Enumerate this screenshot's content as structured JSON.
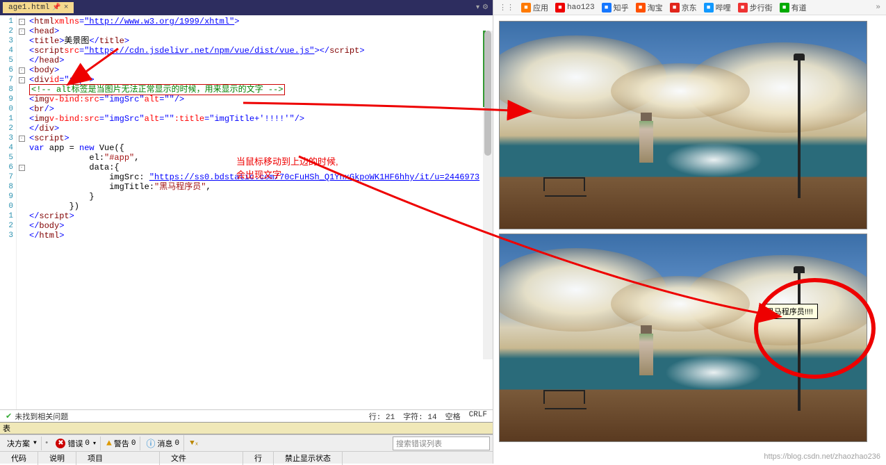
{
  "tab": {
    "filename": "age1.html",
    "pin_icon": "📌",
    "close_icon": "×"
  },
  "code": {
    "lines": [
      {
        "n": "1",
        "fold": "-",
        "html": "<span class='c-punct'>&lt;</span><span class='c-tag'>html</span> <span class='c-attr'>xmlns</span><span class='c-punct'>=</span><span class='c-link'>\"http://www.w3.org/1999/xhtml\"</span><span class='c-punct'>&gt;</span>"
      },
      {
        "n": "2",
        "fold": "-",
        "html": "<span class='c-punct'>&lt;</span><span class='c-tag'>head</span><span class='c-punct'>&gt;</span>"
      },
      {
        "n": "3",
        "fold": "",
        "html": "    <span class='c-punct'>&lt;</span><span class='c-tag'>title</span><span class='c-punct'>&gt;</span>美景图<span class='c-punct'>&lt;/</span><span class='c-tag'>title</span><span class='c-punct'>&gt;</span>"
      },
      {
        "n": "4",
        "fold": "",
        "html": "    <span class='c-punct'>&lt;</span><span class='c-tag'>script</span> <span class='c-attr'>src</span><span class='c-punct'>=</span><span class='c-link'>\"https://cdn.jsdelivr.net/npm/vue/dist/vue.js\"</span><span class='c-punct'>&gt;&lt;/</span><span class='c-tag'>script</span><span class='c-punct'>&gt;</span>"
      },
      {
        "n": "5",
        "fold": "",
        "html": "<span class='c-punct'>&lt;/</span><span class='c-tag'>head</span><span class='c-punct'>&gt;</span>"
      },
      {
        "n": "6",
        "fold": "-",
        "html": "<span class='c-punct'>&lt;</span><span class='c-tag'>body</span><span class='c-punct'>&gt;</span>"
      },
      {
        "n": "7",
        "fold": "-",
        "html": "    <span class='c-punct'>&lt;</span><span class='c-tag'>div</span> <span class='c-attr'>id</span><span class='c-punct'>=</span><span class='c-str'>\"app\"</span><span class='c-punct'>&gt;</span>"
      },
      {
        "n": "8",
        "fold": "",
        "html": "        <span class='hl-box'><span class='c-comment'>&lt;!-- alt标签是当图片无法正常显示的时候，用来显示的文字 --&gt;</span></span>"
      },
      {
        "n": "9",
        "fold": "",
        "html": "        <span class='c-punct'>&lt;</span><span class='c-tag'>img</span> <span class='c-attr'>v-bind:src</span><span class='c-punct'>=</span><span class='c-str'>\"imgSrc\"</span>   <span class='c-attr'>alt</span><span class='c-punct'>=</span><span class='c-str'>\"\"</span> <span class='c-punct'>/&gt;</span>"
      },
      {
        "n": "0",
        "fold": "",
        "html": "        <span class='c-punct'>&lt;</span><span class='c-tag'>br</span> <span class='c-punct'>/&gt;</span>"
      },
      {
        "n": "1",
        "fold": "",
        "html": "        <span class='c-punct'>&lt;</span><span class='c-tag'>img</span> <span class='c-attr'>v-bind:src</span><span class='c-punct'>=</span><span class='c-str'>\"imgSrc\"</span> <span class='c-attr'>alt</span><span class='c-punct'>=</span><span class='c-str'>\"\"</span> <span class='c-attr'>:title</span><span class='c-punct'>=</span><span class='c-str'>\"imgTitle+'!!!!'\"</span> <span class='c-punct'>/&gt;</span>"
      },
      {
        "n": "2",
        "fold": "",
        "html": "    <span class='c-punct'>&lt;/</span><span class='c-tag'>div</span><span class='c-punct'>&gt;</span>"
      },
      {
        "n": "3",
        "fold": "-",
        "html": "    <span class='c-punct'>&lt;</span><span class='c-tag'>script</span><span class='c-punct'>&gt;</span>"
      },
      {
        "n": "4",
        "fold": "",
        "html": "        <span class='c-kw'>var</span> app = <span class='c-kw'>new</span> Vue({"
      },
      {
        "n": "5",
        "fold": "",
        "html": "            el:<span class='c-jsstr'>\"#app\"</span>,"
      },
      {
        "n": "6",
        "fold": "-",
        "html": "            data:{"
      },
      {
        "n": "7",
        "fold": "",
        "html": "                imgSrc: <span class='c-link'>\"https://ss0.bdstatic.com/70cFuHSh_Q1YnxGkpoWK1HF6hhy/it/u=2446973</span>"
      },
      {
        "n": "8",
        "fold": "",
        "html": "                imgTitle:<span class='c-jsstr'>\"黑马程序员\"</span>,"
      },
      {
        "n": "9",
        "fold": "",
        "html": "            }"
      },
      {
        "n": "0",
        "fold": "",
        "html": "        })"
      },
      {
        "n": "1",
        "fold": "",
        "html": "    <span class='c-punct'>&lt;/</span><span class='c-tag'>script</span><span class='c-punct'>&gt;</span>"
      },
      {
        "n": "2",
        "fold": "",
        "html": "<span class='c-punct'>&lt;/</span><span class='c-tag'>body</span><span class='c-punct'>&gt;</span>"
      },
      {
        "n": "3",
        "fold": "",
        "html": "<span class='c-punct'>&lt;/</span><span class='c-tag'>html</span><span class='c-punct'>&gt;</span>"
      }
    ]
  },
  "annotations": {
    "text1_line1": "当鼠标移动到上边的时候,",
    "text1_line2": "会出现文字"
  },
  "status1": {
    "no_issues": "未找到相关问题",
    "line_label": "行: 21",
    "char_label": "字符: 14",
    "space_label": "空格",
    "crlf_label": "CRLF"
  },
  "title2": {
    "label": "表"
  },
  "toolbar2": {
    "solution": "决方案",
    "errors_label": "错误",
    "errors_count": "0",
    "warnings_label": "警告",
    "warnings_count": "0",
    "messages_label": "消息",
    "messages_count": "0",
    "search_placeholder": "搜索错误列表"
  },
  "bottom_tabs": {
    "code": "代码",
    "desc": "说明",
    "project": "项目",
    "file": "文件",
    "line": "行",
    "suppress": "禁止显示状态"
  },
  "bookmarks": [
    {
      "color": "#ff7a00",
      "label": "应用"
    },
    {
      "color": "#e00",
      "label": "hao123"
    },
    {
      "color": "#1677ff",
      "label": "知乎"
    },
    {
      "color": "#ff5000",
      "label": "淘宝"
    },
    {
      "color": "#e1251b",
      "label": "京东"
    },
    {
      "color": "#19f",
      "label": "哔哩"
    },
    {
      "color": "#e33",
      "label": "步行街"
    },
    {
      "color": "#0a0",
      "label": "有道"
    }
  ],
  "tooltip": {
    "text": "黑马程序员!!!!"
  },
  "watermark": {
    "text": "https://blog.csdn.net/zhaozhao236"
  }
}
